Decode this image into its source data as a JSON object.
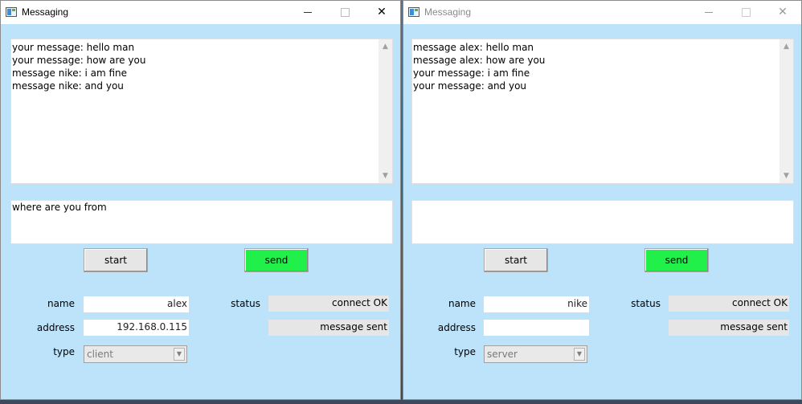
{
  "windows": [
    {
      "title": "Messaging",
      "chat_lines": [
        "your message: hello man",
        "your message: how are you",
        "message nike: i am fine",
        "message nike: and you"
      ],
      "compose_text": "where are you from",
      "buttons": {
        "start": "start",
        "send": "send"
      },
      "labels": {
        "name": "name",
        "address": "address",
        "type": "type",
        "status": "status"
      },
      "name_value": "alex",
      "address_value": "192.168.0.115",
      "type_value": "client",
      "status_1": "connect OK",
      "status_2": "message sent"
    },
    {
      "title": "Messaging",
      "chat_lines": [
        "message alex: hello man",
        "message alex: how are you",
        "your message: i am fine",
        "your message: and you"
      ],
      "compose_text": "",
      "buttons": {
        "start": "start",
        "send": "send"
      },
      "labels": {
        "name": "name",
        "address": "address",
        "type": "type",
        "status": "status"
      },
      "name_value": "nike",
      "address_value": "",
      "type_value": "server",
      "status_1": "connect OK",
      "status_2": "message sent"
    }
  ],
  "icons": {
    "minimize": "minimize-icon",
    "maximize": "maximize-icon",
    "close": "close-icon",
    "scroll_up": "chevron-up-icon",
    "scroll_down": "chevron-down-icon",
    "dropdown": "chevron-down-icon"
  },
  "colors": {
    "window_bg": "#bde3fb",
    "send_button": "#21f04a"
  }
}
